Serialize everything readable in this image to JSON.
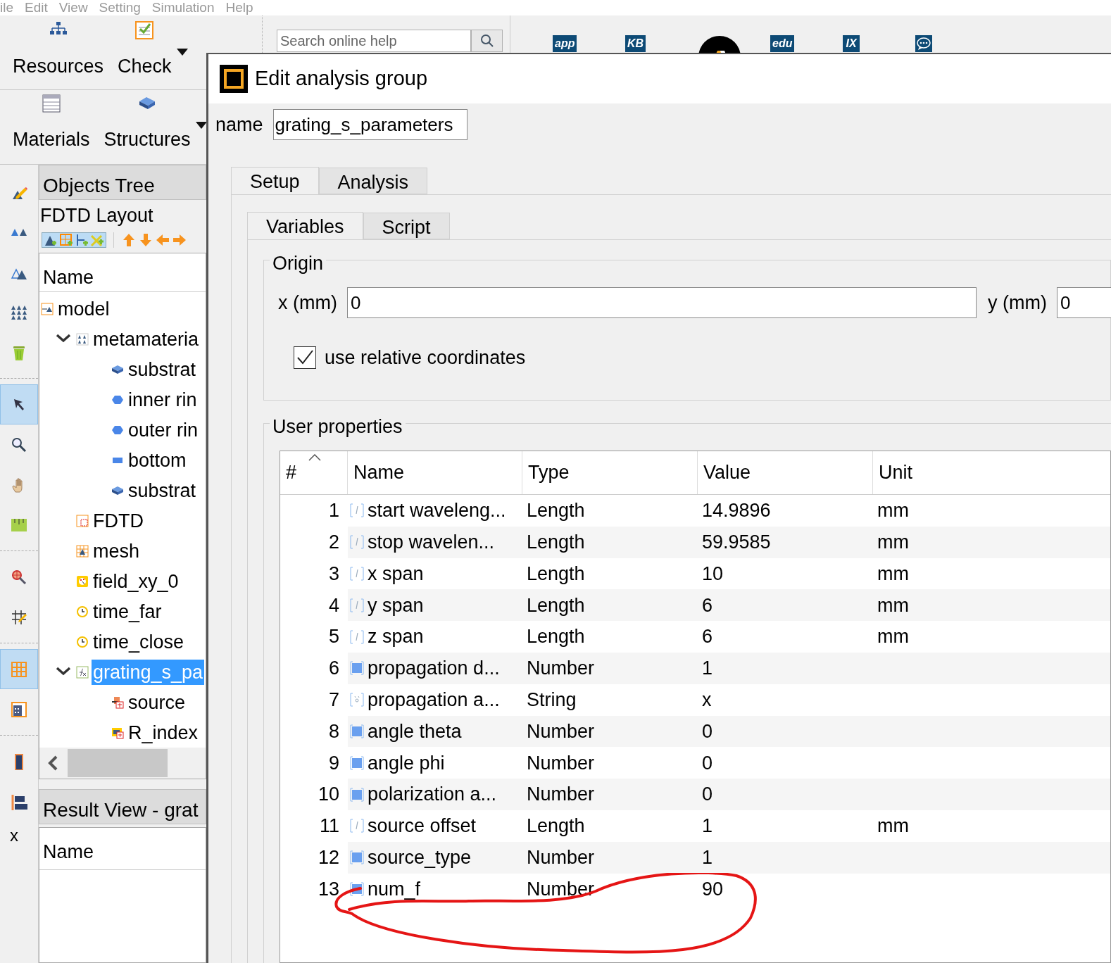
{
  "menu": [
    "ile",
    "Edit",
    "View",
    "Setting",
    "Simulation",
    "Help"
  ],
  "toolbar_row_1": [
    {
      "label": "Resources",
      "kind": "resources",
      "dropdown": false
    },
    {
      "label": "Check",
      "kind": "check",
      "dropdown": true
    }
  ],
  "toolbar_row_2": [
    {
      "label": "Materials",
      "kind": "materials",
      "dropdown": false
    },
    {
      "label": "Structures",
      "kind": "structures",
      "dropdown": true
    }
  ],
  "help_search": {
    "placeholder": "Search online help"
  },
  "link_icons": [
    {
      "label": "app",
      "kind": "text"
    },
    {
      "label": "KB",
      "kind": "text"
    },
    {
      "kind": "logo"
    },
    {
      "label": "edu",
      "kind": "text"
    },
    {
      "label": "IX",
      "kind": "text"
    },
    {
      "kind": "chat"
    }
  ],
  "side_tools": [
    {
      "kind": "draw",
      "selected": false
    },
    {
      "kind": "pair",
      "selected": false
    },
    {
      "kind": "shapes",
      "selected": false
    },
    {
      "kind": "array",
      "selected": false
    },
    {
      "kind": "trash",
      "selected": false
    },
    {
      "kind": "pointer",
      "selected": true
    },
    {
      "kind": "zoom",
      "selected": false
    },
    {
      "kind": "hand",
      "selected": false
    },
    {
      "kind": "ruler",
      "selected": false
    },
    {
      "kind": "target",
      "selected": false
    },
    {
      "kind": "gridedit",
      "selected": false
    },
    {
      "kind": "grid",
      "selected": true
    },
    {
      "kind": "calc",
      "selected": false
    },
    {
      "kind": "bar",
      "selected": false
    },
    {
      "kind": "align",
      "selected": false
    }
  ],
  "side_label": "x",
  "objects_tree": {
    "title": "Objects Tree",
    "layout": "FDTD Layout",
    "column": "Name",
    "items": [
      {
        "label": "model",
        "kind": "model",
        "selected": false,
        "children": [
          {
            "label": "metamateria",
            "kind": "group",
            "expanded": true,
            "selected": false,
            "children": [
              {
                "label": "substrat",
                "kind": "block",
                "selected": false
              },
              {
                "label": "inner rin",
                "kind": "circle",
                "selected": false
              },
              {
                "label": "outer rin",
                "kind": "circle",
                "selected": false
              },
              {
                "label": "bottom",
                "kind": "rect",
                "selected": false
              },
              {
                "label": "substrat",
                "kind": "block",
                "selected": false
              }
            ]
          },
          {
            "label": "FDTD",
            "kind": "fdtd",
            "selected": false
          },
          {
            "label": "mesh",
            "kind": "mesh",
            "selected": false
          },
          {
            "label": "field_xy_0",
            "kind": "monitor",
            "selected": false
          },
          {
            "label": "time_far",
            "kind": "time",
            "selected": false
          },
          {
            "label": "time_close",
            "kind": "time",
            "selected": false
          },
          {
            "label": "grating_s_pa",
            "kind": "analysis",
            "expanded": true,
            "selected": true,
            "children": [
              {
                "label": "source",
                "kind": "source",
                "selected": false
              },
              {
                "label": "R_index",
                "kind": "index",
                "selected": false
              }
            ]
          }
        ]
      }
    ]
  },
  "result_view": {
    "title": "Result View - grat",
    "column": "Name"
  },
  "dialog": {
    "title": "Edit analysis group",
    "name_label": "name",
    "name_value": "grating_s_parameters",
    "tabs": [
      {
        "label": "Setup",
        "selected": true
      },
      {
        "label": "Analysis",
        "selected": false
      }
    ],
    "subtabs": [
      {
        "label": "Variables",
        "selected": true
      },
      {
        "label": "Script",
        "selected": false
      }
    ],
    "origin": {
      "title": "Origin",
      "fields": [
        {
          "label": "x (mm)",
          "value": "0"
        },
        {
          "label": "y (mm)",
          "value": "0"
        }
      ],
      "checkbox": {
        "label": "use relative coordinates",
        "checked": true
      }
    },
    "user_properties": {
      "title": "User properties",
      "columns": [
        "#",
        "Name",
        "Type",
        "Value",
        "Unit"
      ],
      "rows": [
        {
          "index": "1",
          "kind": "length",
          "name": "start waveleng...",
          "type": "Length",
          "value": "14.9896",
          "unit": "mm"
        },
        {
          "index": "2",
          "kind": "length",
          "name": "stop wavelen...",
          "type": "Length",
          "value": "59.9585",
          "unit": "mm"
        },
        {
          "index": "3",
          "kind": "length",
          "name": "x span",
          "type": "Length",
          "value": "10",
          "unit": "mm"
        },
        {
          "index": "4",
          "kind": "length",
          "name": "y span",
          "type": "Length",
          "value": "6",
          "unit": "mm"
        },
        {
          "index": "5",
          "kind": "length",
          "name": "z span",
          "type": "Length",
          "value": "6",
          "unit": "mm"
        },
        {
          "index": "6",
          "kind": "number",
          "name": "propagation d...",
          "type": "Number",
          "value": "1"
        },
        {
          "index": "7",
          "kind": "string",
          "name": "propagation a...",
          "type": "String",
          "value": "x"
        },
        {
          "index": "8",
          "kind": "number",
          "name": "angle theta",
          "type": "Number",
          "value": "0"
        },
        {
          "index": "9",
          "kind": "number",
          "name": "angle phi",
          "type": "Number",
          "value": "0"
        },
        {
          "index": "10",
          "kind": "number",
          "name": "polarization a...",
          "type": "Number",
          "value": "0"
        },
        {
          "index": "11",
          "kind": "length",
          "name": "source offset",
          "type": "Length",
          "value": "1",
          "unit": "mm"
        },
        {
          "index": "12",
          "kind": "number",
          "name": "source_type",
          "type": "Number",
          "value": "1"
        },
        {
          "index": "13",
          "kind": "number",
          "name": "num_f",
          "type": "Number",
          "value": "90"
        }
      ]
    }
  }
}
